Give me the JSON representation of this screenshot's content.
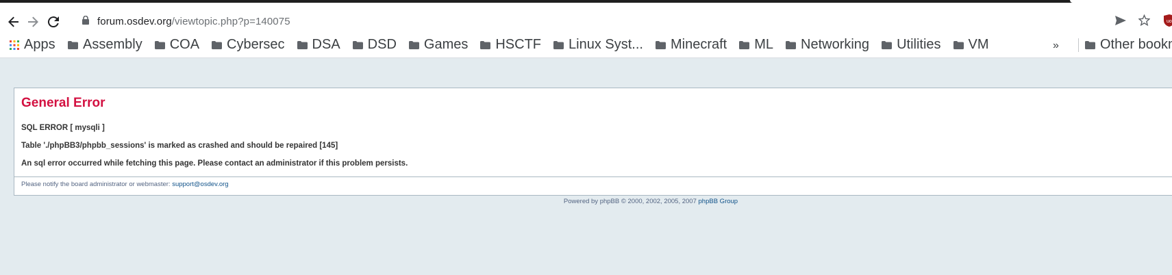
{
  "browser": {
    "url_host": "forum.osdev.org",
    "url_path": "/viewtopic.php?p=140075",
    "icons": {
      "back": "back-arrow-icon",
      "forward": "forward-arrow-icon",
      "reload": "reload-icon",
      "lock": "lock-icon",
      "send": "send-icon",
      "star": "star-icon",
      "extension": "extension-shield-icon"
    }
  },
  "bookmarks": {
    "apps_label": "Apps",
    "items": [
      {
        "label": "Assembly"
      },
      {
        "label": "COA"
      },
      {
        "label": "Cybersec"
      },
      {
        "label": "DSA"
      },
      {
        "label": "DSD"
      },
      {
        "label": "Games"
      },
      {
        "label": "HSCTF"
      },
      {
        "label": "Linux Syst..."
      },
      {
        "label": "Minecraft"
      },
      {
        "label": "ML"
      },
      {
        "label": "Networking"
      },
      {
        "label": "Utilities"
      },
      {
        "label": "VM"
      }
    ],
    "overflow_label": "»",
    "other_label": "Other bookm"
  },
  "error": {
    "title": "General Error",
    "line1": "SQL ERROR [ mysqli ]",
    "line2": "Table './phpBB3/phpbb_sessions' is marked as crashed and should be repaired [145]",
    "line3": "An sql error occurred while fetching this page. Please contact an administrator if this problem persists.",
    "notify_text": "Please notify the board administrator or webmaster: ",
    "notify_email": "support@osdev.org"
  },
  "footer": {
    "powered_text": "Powered by phpBB © 2000, 2002, 2005, 2007 ",
    "group_link": "phpBB Group"
  },
  "colors": {
    "page_bg": "#e3ebef",
    "error_title": "#d31141",
    "link": "#105289"
  }
}
